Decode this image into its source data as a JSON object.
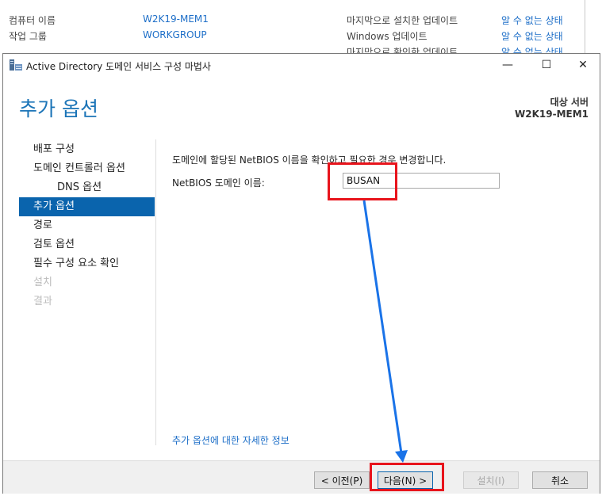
{
  "background": {
    "rows": [
      {
        "label": "컴퓨터 이름",
        "value": "W2K19-MEM1",
        "label2": "마지막으로 설치한 업데이트",
        "value2": "알 수 없는 상태"
      },
      {
        "label": "작업 그룹",
        "value": "WORKGROUP",
        "label2": "Windows 업데이트",
        "value2": "알 수 없는 상태"
      },
      {
        "label2": "마지막으로 확인한 업데이트",
        "value2": "알 수 없는 상태"
      }
    ]
  },
  "window": {
    "title": "Active Directory 도메인 서비스 구성 마법사",
    "minimize_glyph": "—",
    "maximize_glyph": "☐",
    "close_glyph": "✕"
  },
  "page": {
    "title": "추가 옵션",
    "target_label": "대상 서버",
    "target_value": "W2K19-MEM1"
  },
  "nav": {
    "items": [
      {
        "label": "배포 구성",
        "state": "normal"
      },
      {
        "label": "도메인 컨트롤러 옵션",
        "state": "normal"
      },
      {
        "label": "DNS 옵션",
        "state": "sub"
      },
      {
        "label": "추가 옵션",
        "state": "active"
      },
      {
        "label": "경로",
        "state": "normal"
      },
      {
        "label": "검토 옵션",
        "state": "normal"
      },
      {
        "label": "필수 구성 요소 확인",
        "state": "normal"
      },
      {
        "label": "설치",
        "state": "disabled"
      },
      {
        "label": "결과",
        "state": "disabled"
      }
    ]
  },
  "content": {
    "description": "도메인에 할당된 NetBIOS 이름을 확인하고 필요한 경우 변경합니다.",
    "netbios_label": "NetBIOS 도메인 이름:",
    "netbios_value": "BUSAN",
    "more_link": "추가 옵션에 대한 자세한 정보"
  },
  "buttons": {
    "prev": "< 이전(P)",
    "next": "다음(N) >",
    "install": "설치(I)",
    "cancel": "취소"
  },
  "colors": {
    "accent": "#0a64ad",
    "title": "#1b74b7",
    "link": "#1e6fc8",
    "annotation": "#e8141c",
    "arrow": "#1a73e8"
  }
}
